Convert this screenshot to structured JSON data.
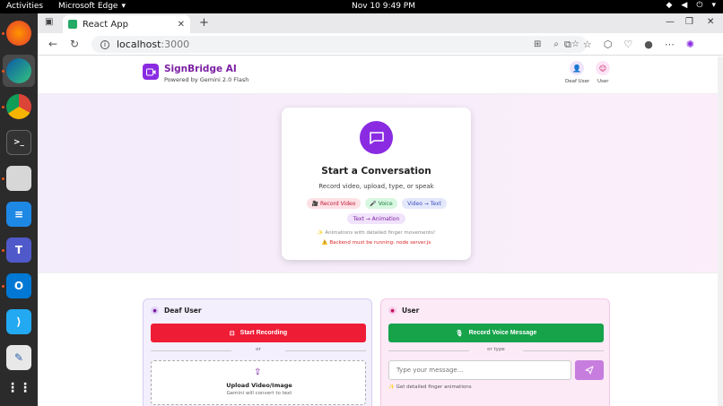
{
  "os": {
    "activities": "Activities",
    "app_name": "Microsoft Edge",
    "clock": "Nov 10  9:49 PM"
  },
  "browser": {
    "tab_title": "React App",
    "url_host": "localhost",
    "url_port": ":3000"
  },
  "header": {
    "brand": "SignBridge AI",
    "tagline": "Powered by Gemini 2.0 Flash",
    "deaf_user_label": "Deaf User",
    "user_label": "User"
  },
  "hero": {
    "title": "Start a Conversation",
    "subtitle": "Record video, upload, type, or speak",
    "chips": [
      "🎥 Record Video",
      "🎤 Voice",
      "Video → Text",
      "Text → Animation"
    ],
    "note1": "✨ Animations with detailed finger movements!",
    "note2": "⚠️ Backend must be running: node server.js"
  },
  "deaf_panel": {
    "title": "Deaf User",
    "record_button": "Start Recording",
    "or": "or",
    "upload_title": "Upload Video/Image",
    "upload_sub": "Gemini will convert to text"
  },
  "user_panel": {
    "title": "User",
    "voice_button": "Record Voice Message",
    "or_type": "or type",
    "input_placeholder": "Type your message...",
    "hint": "✨ Get detailed finger animations"
  },
  "colors": {
    "brand": "#8a2be2",
    "record_red": "#ef1c35",
    "voice_green": "#16a34a",
    "send_purple": "#c77dde"
  }
}
